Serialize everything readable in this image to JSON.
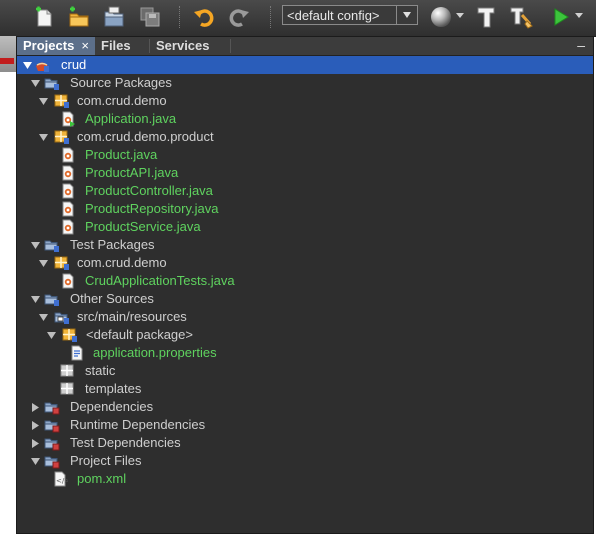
{
  "toolbar": {
    "config_value": "<default config>"
  },
  "tabs": [
    {
      "label": "Projects",
      "close": "×"
    },
    {
      "label": "Files"
    },
    {
      "label": "Services"
    }
  ],
  "minimize_glyph": "–",
  "tree": [
    {
      "label": "crud",
      "icon": "maven-project-icon",
      "expanded": true,
      "selected": true
    },
    {
      "label": "Source Packages",
      "icon": "source-folder-icon",
      "expanded": true
    },
    {
      "label": "com.crud.demo",
      "icon": "package-icon",
      "expanded": true
    },
    {
      "label": "Application.java",
      "icon": "java-main-class-icon",
      "green": true
    },
    {
      "label": "com.crud.demo.product",
      "icon": "package-icon",
      "expanded": true
    },
    {
      "label": "Product.java",
      "icon": "java-file-icon",
      "green": true
    },
    {
      "label": "ProductAPI.java",
      "icon": "java-file-icon",
      "green": true
    },
    {
      "label": "ProductController.java",
      "icon": "java-file-icon",
      "green": true
    },
    {
      "label": "ProductRepository.java",
      "icon": "java-file-icon",
      "green": true
    },
    {
      "label": "ProductService.java",
      "icon": "java-file-icon",
      "green": true
    },
    {
      "label": "Test Packages",
      "icon": "source-folder-icon",
      "expanded": true
    },
    {
      "label": "com.crud.demo",
      "icon": "package-icon",
      "expanded": true
    },
    {
      "label": "CrudApplicationTests.java",
      "icon": "java-file-icon",
      "green": true
    },
    {
      "label": "Other Sources",
      "icon": "source-folder-icon",
      "expanded": true
    },
    {
      "label": "src/main/resources",
      "icon": "resource-folder-icon",
      "expanded": true
    },
    {
      "label": "<default package>",
      "icon": "package-icon",
      "expanded": true
    },
    {
      "label": "application.properties",
      "icon": "properties-file-icon",
      "green": true
    },
    {
      "label": "static",
      "icon": "empty-package-icon"
    },
    {
      "label": "templates",
      "icon": "empty-package-icon"
    },
    {
      "label": "Dependencies",
      "icon": "library-folder-icon",
      "expanded": false
    },
    {
      "label": "Runtime Dependencies",
      "icon": "library-folder-icon",
      "expanded": false
    },
    {
      "label": "Test Dependencies",
      "icon": "library-folder-icon",
      "expanded": false
    },
    {
      "label": "Project Files",
      "icon": "library-folder-icon",
      "expanded": true
    },
    {
      "label": "pom.xml",
      "icon": "xml-file-icon",
      "green": true
    }
  ]
}
